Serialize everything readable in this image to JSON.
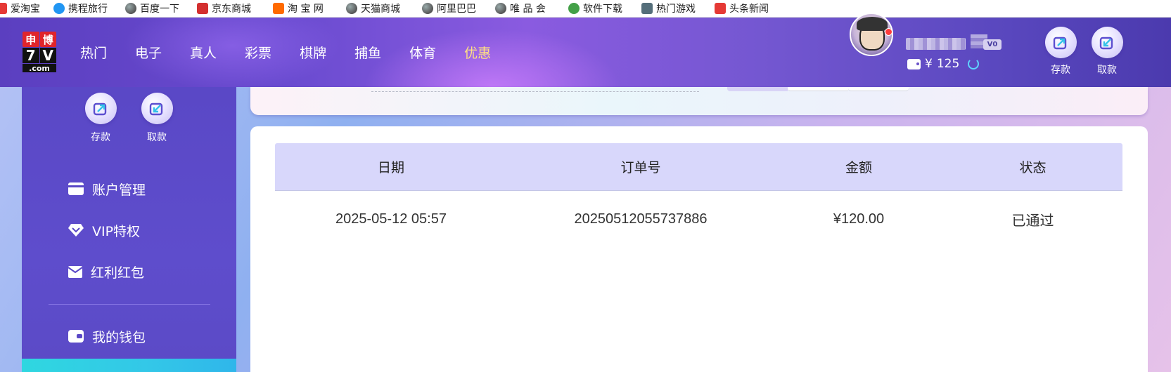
{
  "bookmarks": [
    {
      "label": "爱淘宝",
      "icon": "taobao-icon",
      "color": "#e53935"
    },
    {
      "label": "携程旅行",
      "icon": "ctrip-icon",
      "color": "#2196f3"
    },
    {
      "label": "百度一下",
      "icon": "globe-icon",
      "color": "#555555"
    },
    {
      "label": "京东商城",
      "icon": "jd-icon",
      "color": "#d32f2f"
    },
    {
      "label": "淘 宝 网",
      "icon": "taobao-icon",
      "color": "#ff6a00"
    },
    {
      "label": "天猫商城",
      "icon": "globe-icon",
      "color": "#555555"
    },
    {
      "label": "阿里巴巴",
      "icon": "globe-icon",
      "color": "#555555"
    },
    {
      "label": "唯 品 会",
      "icon": "globe-icon",
      "color": "#555555"
    },
    {
      "label": "软件下载",
      "icon": "download-icon",
      "color": "#43a047"
    },
    {
      "label": "热门游戏",
      "icon": "game-icon",
      "color": "#546e7a"
    },
    {
      "label": "头条新闻",
      "icon": "news-icon",
      "color": "#e53935"
    }
  ],
  "logo": {
    "top_left": "申",
    "top_right": "博",
    "mid_left": "7",
    "mid_right": "V",
    "bottom": ".com"
  },
  "nav": [
    {
      "label": "热门"
    },
    {
      "label": "电子"
    },
    {
      "label": "真人"
    },
    {
      "label": "彩票"
    },
    {
      "label": "棋牌"
    },
    {
      "label": "捕鱼"
    },
    {
      "label": "体育"
    },
    {
      "label": "优惠",
      "active": true
    }
  ],
  "user": {
    "vip": "V0",
    "currency": "¥",
    "balance": "125"
  },
  "header_actions": {
    "deposit": "存款",
    "withdraw": "取款"
  },
  "sidebar": {
    "deposit": "存款",
    "withdraw": "取款",
    "items": [
      {
        "label": "账户管理",
        "icon": "card-icon"
      },
      {
        "label": "VIP特权",
        "icon": "diamond-icon"
      },
      {
        "label": "红利红包",
        "icon": "envelope-icon"
      },
      {
        "label": "我的钱包",
        "icon": "wallet-icon"
      }
    ]
  },
  "table": {
    "headers": [
      "日期",
      "订单号",
      "金额",
      "状态"
    ],
    "rows": [
      {
        "date": "2025-05-12 05:57",
        "order_no": "20250512055737886",
        "amount": "¥120.00",
        "status": "已通过"
      }
    ]
  },
  "colors": {
    "accent": "#ffe083",
    "header_row": "#d8d7fb",
    "sidebar": "#5a48c6",
    "active_tab": "#2fd7e0"
  }
}
